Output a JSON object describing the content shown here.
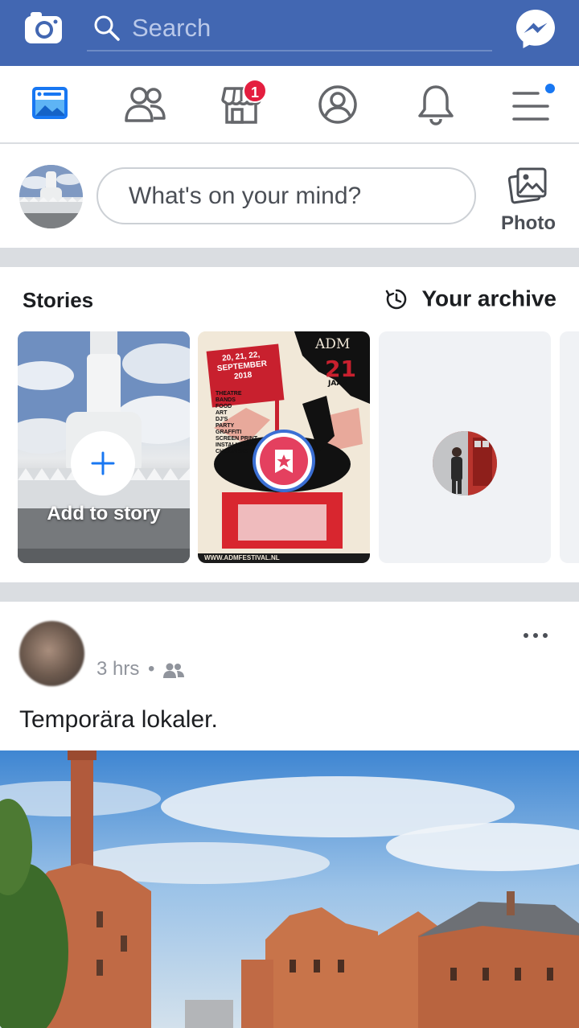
{
  "header": {
    "search_placeholder": "Search",
    "brand_color": "#4267b2"
  },
  "nav": {
    "marketplace_badge": "1",
    "items": [
      "news-feed",
      "friends",
      "marketplace",
      "profile",
      "notifications",
      "menu"
    ]
  },
  "composer": {
    "prompt": "What's on your mind?",
    "photo_label": "Photo"
  },
  "stories": {
    "title": "Stories",
    "archive_label": "Your archive",
    "add_label": "Add to story",
    "poster": {
      "title": "ADM",
      "dates": "20, 21, 22, SEPTEMBER 2018",
      "years": "21",
      "years_unit": "JAAR",
      "lineup": [
        "THEATRE",
        "BANDS",
        "FOOD",
        "ART",
        "DJ'S",
        "PARTY",
        "GRAFFITI",
        "SCREEN PRINT",
        "INSTALLATIONS",
        "CHILDRENS SPACE"
      ],
      "url": "WWW.ADMFESTIVAL.NL"
    }
  },
  "post": {
    "time": "3 hrs",
    "separator": "•",
    "text": "Temporära lokaler."
  }
}
